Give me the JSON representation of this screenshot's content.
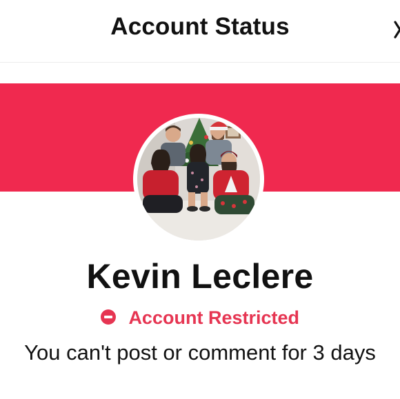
{
  "header": {
    "title": "Account Status",
    "close_icon": "close-icon"
  },
  "profile": {
    "name": "Kevin Leclere",
    "avatar_icon": "profile-photo"
  },
  "status": {
    "label": "Account Restricted",
    "icon": "no-entry-icon"
  },
  "message": "You can't post or comment for 3 days",
  "colors": {
    "brand_red": "#f0294f",
    "status_red": "#e63552",
    "text": "#111111"
  }
}
